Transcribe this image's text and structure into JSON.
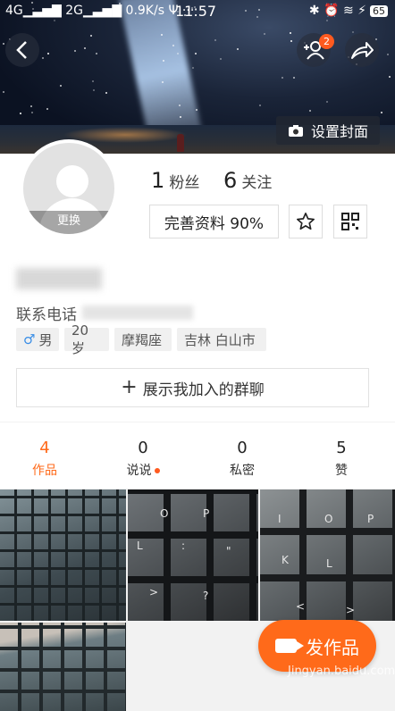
{
  "status_bar": {
    "left": "4G▁▃▅▇ 2G▁▃▅▇ 0.9K/s Ψ ···",
    "time": "11:57",
    "battery": "65"
  },
  "header": {
    "back_icon": "chevron-left-icon",
    "notification_count": "2",
    "share_icon": "share-arrow-icon",
    "set_cover_label": "设置封面"
  },
  "profile": {
    "avatar_change_label": "更换",
    "followers_count": "1",
    "followers_label": "粉丝",
    "following_count": "6",
    "following_label": "关注",
    "complete_profile_label": "完善资料 90%",
    "phone_label": "联系电话",
    "tags": {
      "gender": "男",
      "age": "20岁",
      "zodiac": "摩羯座",
      "location": "吉林 白山市"
    },
    "join_groups_label": "展示我加入的群聊"
  },
  "stats": [
    {
      "count": "4",
      "label": "作品"
    },
    {
      "count": "0",
      "label": "说说"
    },
    {
      "count": "0",
      "label": "私密"
    },
    {
      "count": "5",
      "label": "赞"
    }
  ],
  "publish_label": "发作品",
  "watermark": "Jingyan.baidu.com",
  "colors": {
    "accent": "#ff6a1a",
    "badge": "#ff5a1f"
  }
}
